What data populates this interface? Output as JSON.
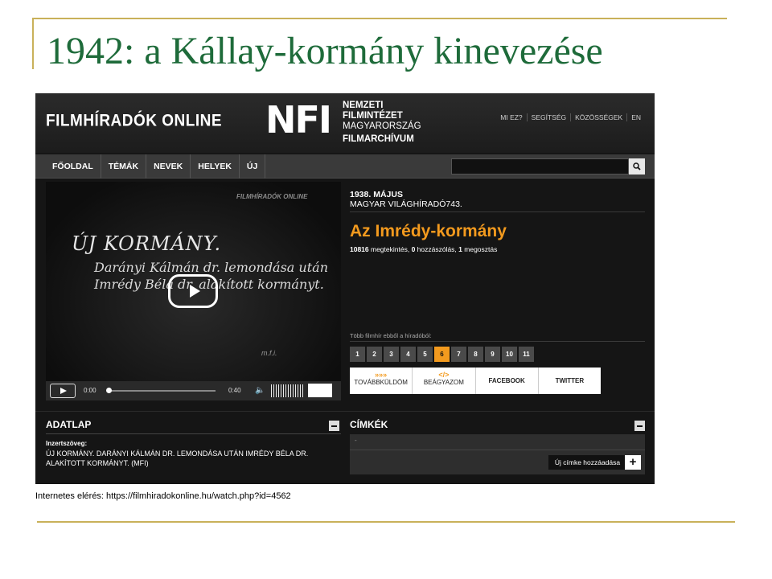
{
  "slide": {
    "title": "1942: a Kállay-kormány kinevezése",
    "caption": "Internetes elérés: https://filmhiradokonline.hu/watch.php?id=4562"
  },
  "site": {
    "logo": "FILMHÍRADÓK ONLINE",
    "nfi_mark": "NFI",
    "nfi_lines": [
      "NEMZETI",
      "FILMINTÉZET",
      "MAGYARORSZÁG",
      "FILMARCHÍVUM"
    ],
    "top_links": [
      "MI EZ?",
      "SEGÍTSÉG",
      "KÖZÖSSÉGEK",
      "EN"
    ],
    "nav": [
      "FŐOLDAL",
      "TÉMÁK",
      "NEVEK",
      "HELYEK",
      "ÚJ"
    ]
  },
  "video": {
    "watermark": "FILMHÍRADÓK ONLINE",
    "frame_title": "ÚJ KORMÁNY.",
    "frame_text": "Darányi Kálmán dr. lemondása után Imrédy Béla dr. alakított kormányt.",
    "frame_signature": "m.f.i.",
    "time_current": "0:00",
    "time_total": "0:40",
    "progress": 0
  },
  "info": {
    "date": "1938. MÁJUS",
    "series": "MAGYAR VILÁGHÍRADÓ743.",
    "title": "Az Imrédy-kormány",
    "views": "10816",
    "views_label": " megtekintés, ",
    "comments": "0",
    "comments_label": " hozzászólás, ",
    "shares": "1",
    "shares_label": " megosztás",
    "more_label": "Több filmhír ebből a híradóból:",
    "pages": [
      "1",
      "2",
      "3",
      "4",
      "5",
      "6",
      "7",
      "8",
      "9",
      "10",
      "11"
    ],
    "active_page": "6",
    "share": {
      "forward_icon": "»»»",
      "forward": "TOVÁBBKÜLDÖM",
      "embed_icon": "</>",
      "embed": "BEÁGYAZOM",
      "facebook": "FACEBOOK",
      "twitter": "TWITTER"
    }
  },
  "adatlap": {
    "heading": "ADATLAP",
    "label": "Inzertszöveg:",
    "text": "ÚJ KORMÁNY. DARÁNYI KÁLMÁN DR. LEMONDÁSA UTÁN IMRÉDY BÉLA DR. ALAKÍTOTT KORMÁNYT. (MFI)"
  },
  "cimkek": {
    "heading": "CÍMKÉK",
    "empty": "-",
    "add_label": "Új címke hozzáadása",
    "add_icon": "+"
  },
  "colors": {
    "accent": "#f39a1e",
    "title_green": "#1e6b3a",
    "rule_gold": "#c9b15a"
  }
}
